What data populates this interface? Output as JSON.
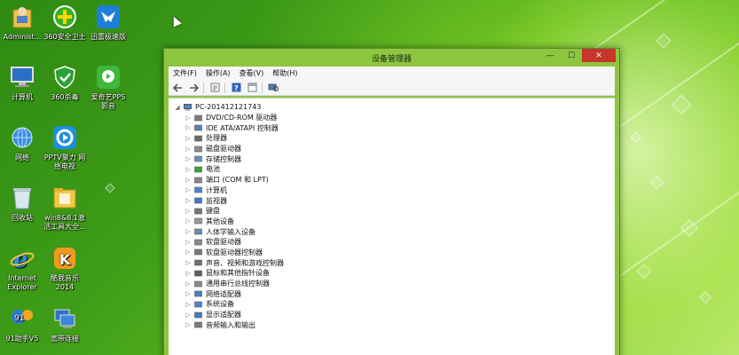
{
  "desktop": {
    "icons": [
      {
        "label": "Administ...",
        "icon": "user-folder-icon"
      },
      {
        "label": "360安全卫士",
        "icon": "360-security-icon"
      },
      {
        "label": "迅雷极速版",
        "icon": "xunlei-icon"
      },
      {
        "label": "计算机",
        "icon": "computer-icon"
      },
      {
        "label": "360杀毒",
        "icon": "360-antivirus-icon"
      },
      {
        "label": "爱奇艺PPS\n影音",
        "icon": "iqiyi-pps-icon"
      },
      {
        "label": "网络",
        "icon": "network-icon"
      },
      {
        "label": "PPTV聚力 网\n络电视",
        "icon": "pptv-icon"
      },
      {
        "label": "回收站",
        "icon": "recycle-bin-icon"
      },
      {
        "label": "win8&8.1激\n活工具大全...",
        "icon": "folder-tools-icon"
      },
      {
        "label": "Internet\nExplorer",
        "icon": "ie-icon"
      },
      {
        "label": "酷我音乐\n2014",
        "icon": "kuwo-music-icon"
      },
      {
        "label": "91助手V5",
        "icon": "91-assistant-icon"
      },
      {
        "label": "宽带连接",
        "icon": "broadband-icon"
      }
    ]
  },
  "window": {
    "title": "设备管理器",
    "controls": {
      "minimize": "—",
      "maximize": "☐",
      "close": "✕"
    },
    "menu": [
      "文件(F)",
      "操作(A)",
      "查看(V)",
      "帮助(H)"
    ],
    "toolbar": [
      "back-arrow-icon",
      "forward-arrow-icon",
      "properties-icon",
      "help-icon",
      "show-hide-icon",
      "scan-hardware-icon"
    ],
    "tree": {
      "root": "PC-201412121743",
      "items": [
        "DVD/CD-ROM 驱动器",
        "IDE ATA/ATAPI 控制器",
        "处理器",
        "磁盘驱动器",
        "存储控制器",
        "电池",
        "端口 (COM 和 LPT)",
        "计算机",
        "监视器",
        "键盘",
        "其他设备",
        "人体学输入设备",
        "软盘驱动器",
        "软盘驱动器控制器",
        "声音、视频和游戏控制器",
        "鼠标和其他指针设备",
        "通用串行总线控制器",
        "网络适配器",
        "系统设备",
        "显示适配器",
        "音频输入和输出"
      ]
    }
  }
}
